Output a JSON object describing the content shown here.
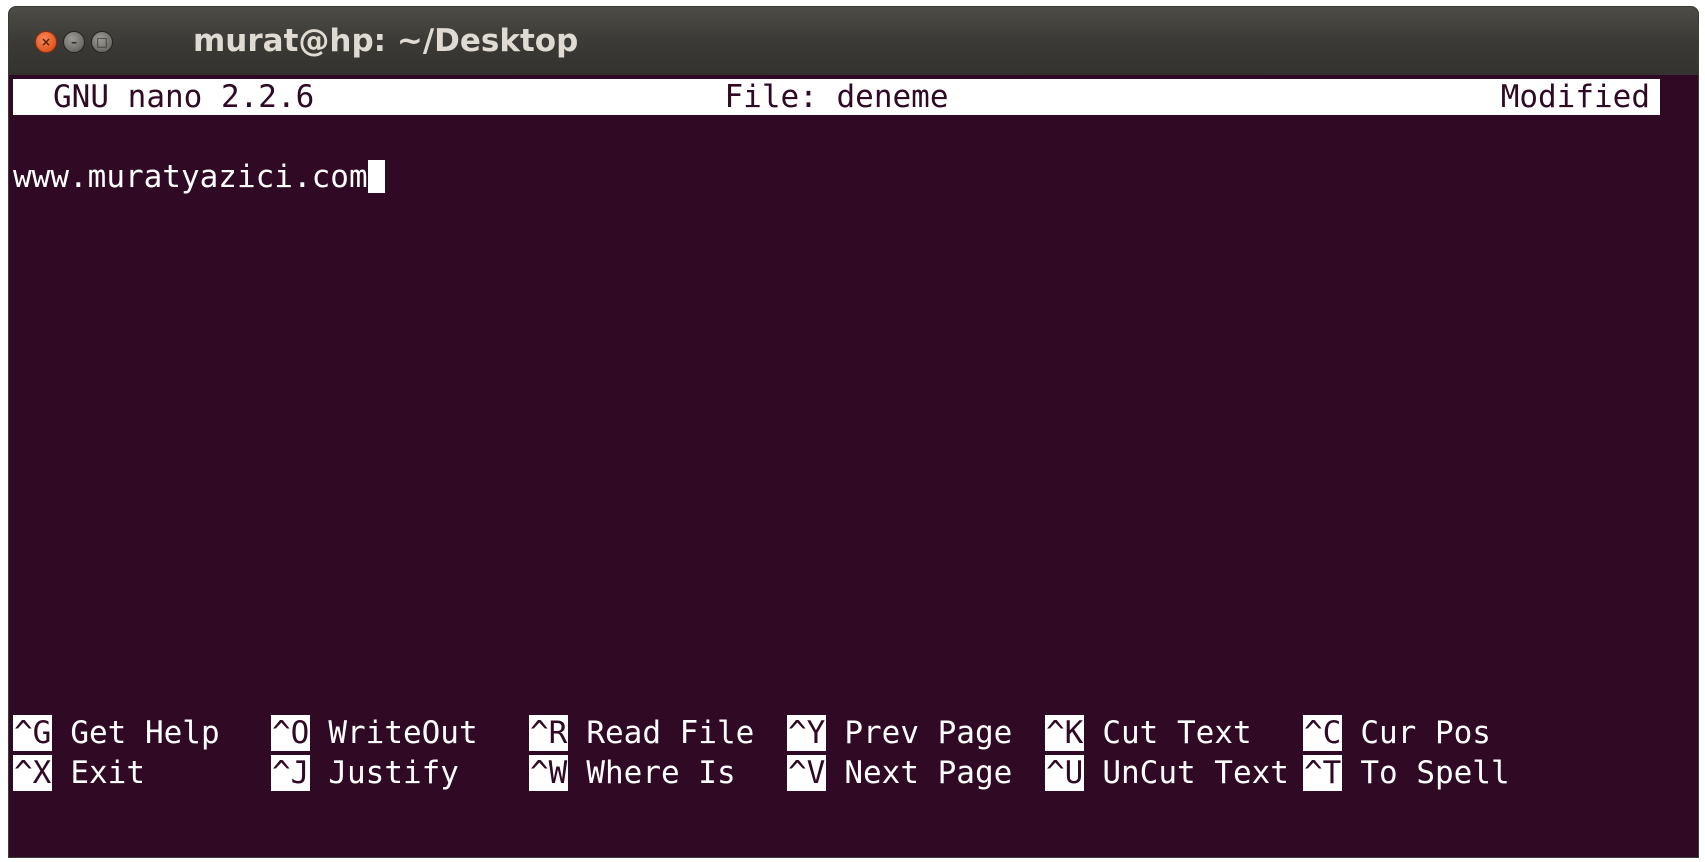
{
  "window": {
    "title": "murat@hp: ~/Desktop",
    "buttons": {
      "close_symbol": "×",
      "minimize_symbol": "–",
      "maximize_symbol": "□"
    }
  },
  "nano": {
    "header": {
      "version": "GNU nano 2.2.6",
      "file": "File: deneme",
      "status": "Modified"
    },
    "content": {
      "line1": "www.muratyazici.com"
    },
    "shortcuts": {
      "row1": [
        {
          "key": "^G",
          "label": "Get Help"
        },
        {
          "key": "^O",
          "label": "WriteOut"
        },
        {
          "key": "^R",
          "label": "Read File"
        },
        {
          "key": "^Y",
          "label": "Prev Page"
        },
        {
          "key": "^K",
          "label": "Cut Text"
        },
        {
          "key": "^C",
          "label": "Cur Pos"
        }
      ],
      "row2": [
        {
          "key": "^X",
          "label": "Exit"
        },
        {
          "key": "^J",
          "label": "Justify"
        },
        {
          "key": "^W",
          "label": "Where Is"
        },
        {
          "key": "^V",
          "label": "Next Page"
        },
        {
          "key": "^U",
          "label": "UnCut Text"
        },
        {
          "key": "^T",
          "label": "To Spell"
        }
      ]
    }
  },
  "colors": {
    "terminal_background": "#300a24",
    "terminal_foreground": "#ffffff",
    "titlebar": "#3c3b37",
    "close_button": "#e2571e"
  }
}
